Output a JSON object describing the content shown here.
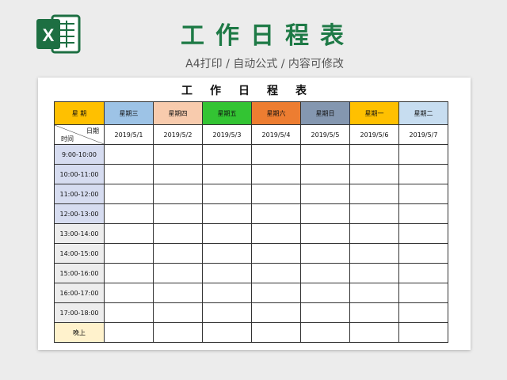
{
  "header": {
    "logo_letter": "X",
    "title": "工作日程表",
    "subtitle": "A4打印 / 自动公式 / 内容可修改"
  },
  "sheet": {
    "title": "工作日程表",
    "corner_label": "星 期",
    "diag_top": "日期",
    "diag_bottom": "时间",
    "days": [
      {
        "label": "星期三",
        "date": "2019/5/1",
        "color": "#9dc3e6"
      },
      {
        "label": "星期四",
        "date": "2019/5/2",
        "color": "#f8cbad"
      },
      {
        "label": "星期五",
        "date": "2019/5/3",
        "color": "#33c433"
      },
      {
        "label": "星期六",
        "date": "2019/5/4",
        "color": "#ed7d31"
      },
      {
        "label": "星期日",
        "date": "2019/5/5",
        "color": "#8497b0"
      },
      {
        "label": "星期一",
        "date": "2019/5/6",
        "color": "#ffc000"
      },
      {
        "label": "星期二",
        "date": "2019/5/7",
        "color": "#c7ddf0"
      }
    ],
    "slots": [
      {
        "label": "9:00-10:00",
        "color": "#d6dcf0"
      },
      {
        "label": "10:00-11:00",
        "color": "#d6dcf0"
      },
      {
        "label": "11:00-12:00",
        "color": "#d6dcf0"
      },
      {
        "label": "12:00-13:00",
        "color": "#d6dcf0"
      },
      {
        "label": "13:00-14:00",
        "color": "#ededed"
      },
      {
        "label": "14:00-15:00",
        "color": "#ededed"
      },
      {
        "label": "15:00-16:00",
        "color": "#ededed"
      },
      {
        "label": "16:00-17:00",
        "color": "#ededed"
      },
      {
        "label": "17:00-18:00",
        "color": "#ededed"
      },
      {
        "label": "晚上",
        "color": "#fff2cc"
      }
    ],
    "colors": {
      "corner": "#ffc000",
      "title_green": "#1e7a46",
      "logo_green": "#1d6f42"
    }
  }
}
